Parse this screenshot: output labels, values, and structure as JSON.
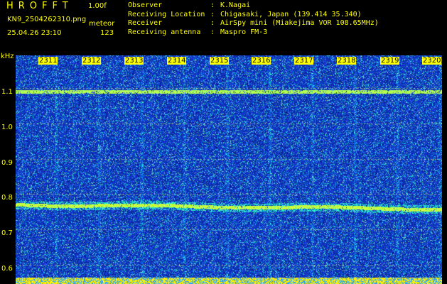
{
  "header": {
    "app_title": "HROFFT",
    "version": "1.00f",
    "filename": "KN9_2504262310.png",
    "mode": "meteor",
    "datetime": "25.04.26 23:10",
    "count": "123"
  },
  "info": [
    {
      "key": "Observer",
      "sep": ":",
      "value": "K.Nagai"
    },
    {
      "key": "Receiving Location",
      "sep": ":",
      "value": "Chigasaki, Japan (139.414 35.340)"
    },
    {
      "key": "Receiver",
      "sep": ":",
      "value": "AirSpy mini (Miakejima VOR 108.65MHz)"
    },
    {
      "key": "Receiving antenna",
      "sep": ":",
      "value": "Maspro FM-3"
    }
  ],
  "axis": {
    "y_unit": "kHz",
    "y_ticks": [
      "1.1",
      "1.0",
      "0.9",
      "0.8",
      "0.7",
      "0.6"
    ],
    "x_ticks": [
      "2311",
      "2312",
      "2313",
      "2314",
      "2315",
      "2316",
      "2317",
      "2318",
      "2319",
      "2320"
    ]
  },
  "colors": {
    "background": "#000000",
    "label": "#ffff00",
    "spectrogram_base": "#1a3fd0",
    "carrier_line": "#c8ff40"
  }
}
